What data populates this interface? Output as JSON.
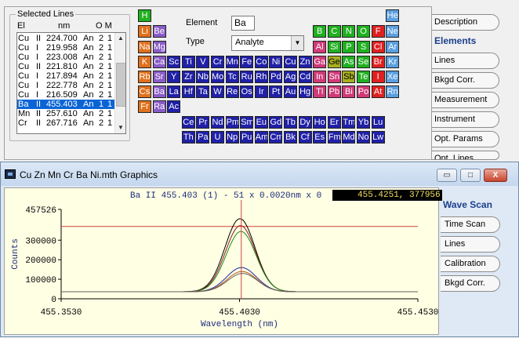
{
  "selected_lines": {
    "title": "Selected Lines",
    "headers": {
      "el": "El",
      "nm": "nm",
      "om": "O M"
    },
    "rows": [
      {
        "el": "Cu",
        "ion": "II",
        "nm": "224.700",
        "o": "An",
        "m1": "2",
        "m2": "1"
      },
      {
        "el": "Cu",
        "ion": "I",
        "nm": "219.958",
        "o": "An",
        "m1": "2",
        "m2": "1"
      },
      {
        "el": "Cu",
        "ion": "I",
        "nm": "223.008",
        "o": "An",
        "m1": "2",
        "m2": "1"
      },
      {
        "el": "Cu",
        "ion": "II",
        "nm": "221.810",
        "o": "An",
        "m1": "2",
        "m2": "1"
      },
      {
        "el": "Cu",
        "ion": "I",
        "nm": "217.894",
        "o": "An",
        "m1": "2",
        "m2": "1"
      },
      {
        "el": "Cu",
        "ion": "I",
        "nm": "222.778",
        "o": "An",
        "m1": "2",
        "m2": "1"
      },
      {
        "el": "Cu",
        "ion": "I",
        "nm": "216.509",
        "o": "An",
        "m1": "2",
        "m2": "1"
      },
      {
        "el": "Ba",
        "ion": "II",
        "nm": "455.403",
        "o": "An",
        "m1": "1",
        "m2": "1",
        "selected": true
      },
      {
        "el": "Mn",
        "ion": "II",
        "nm": "257.610",
        "o": "An",
        "m1": "2",
        "m2": "1"
      },
      {
        "el": "Cr",
        "ion": "II",
        "nm": "267.716",
        "o": "An",
        "m1": "2",
        "m2": "1"
      }
    ]
  },
  "element_form": {
    "element_label": "Element",
    "element_value": "Ba",
    "type_label": "Type",
    "type_value": "Analyte"
  },
  "colors": {
    "orange": "#e0701c",
    "purple": "#8a5cc7",
    "blue": "#2020a8",
    "green": "#20b020",
    "red": "#e02020",
    "light_blue": "#5a9fe0",
    "pink": "#d03a78",
    "olive": "#a8b020",
    "selected_row": "#0a64d6"
  },
  "periodic_table": [
    {
      "s": "H",
      "c": "green",
      "r": 0,
      "col": 0
    },
    {
      "s": "He",
      "c": "light_blue",
      "r": 0,
      "col": 17
    },
    {
      "s": "Li",
      "c": "orange",
      "r": 1,
      "col": 0
    },
    {
      "s": "Be",
      "c": "purple",
      "r": 1,
      "col": 1
    },
    {
      "s": "B",
      "c": "green",
      "r": 1,
      "col": 12
    },
    {
      "s": "C",
      "c": "green",
      "r": 1,
      "col": 13
    },
    {
      "s": "N",
      "c": "green",
      "r": 1,
      "col": 14
    },
    {
      "s": "O",
      "c": "green",
      "r": 1,
      "col": 15
    },
    {
      "s": "F",
      "c": "red",
      "r": 1,
      "col": 16
    },
    {
      "s": "Ne",
      "c": "light_blue",
      "r": 1,
      "col": 17
    },
    {
      "s": "Na",
      "c": "orange",
      "r": 2,
      "col": 0
    },
    {
      "s": "Mg",
      "c": "purple",
      "r": 2,
      "col": 1
    },
    {
      "s": "Al",
      "c": "pink",
      "r": 2,
      "col": 12
    },
    {
      "s": "Si",
      "c": "green",
      "r": 2,
      "col": 13
    },
    {
      "s": "P",
      "c": "green",
      "r": 2,
      "col": 14
    },
    {
      "s": "S",
      "c": "green",
      "r": 2,
      "col": 15
    },
    {
      "s": "Cl",
      "c": "red",
      "r": 2,
      "col": 16
    },
    {
      "s": "Ar",
      "c": "light_blue",
      "r": 2,
      "col": 17
    },
    {
      "s": "K",
      "c": "orange",
      "r": 3,
      "col": 0
    },
    {
      "s": "Ca",
      "c": "purple",
      "r": 3,
      "col": 1
    },
    {
      "s": "Sc",
      "c": "blue",
      "r": 3,
      "col": 2
    },
    {
      "s": "Ti",
      "c": "blue",
      "r": 3,
      "col": 3
    },
    {
      "s": "V",
      "c": "blue",
      "r": 3,
      "col": 4
    },
    {
      "s": "Cr",
      "c": "blue",
      "r": 3,
      "col": 5
    },
    {
      "s": "Mn",
      "c": "blue",
      "r": 3,
      "col": 6
    },
    {
      "s": "Fe",
      "c": "blue",
      "r": 3,
      "col": 7
    },
    {
      "s": "Co",
      "c": "blue",
      "r": 3,
      "col": 8
    },
    {
      "s": "Ni",
      "c": "blue",
      "r": 3,
      "col": 9
    },
    {
      "s": "Cu",
      "c": "blue",
      "r": 3,
      "col": 10
    },
    {
      "s": "Zn",
      "c": "blue",
      "r": 3,
      "col": 11
    },
    {
      "s": "Ga",
      "c": "pink",
      "r": 3,
      "col": 12
    },
    {
      "s": "Ge",
      "c": "olive",
      "r": 3,
      "col": 13
    },
    {
      "s": "As",
      "c": "green",
      "r": 3,
      "col": 14
    },
    {
      "s": "Se",
      "c": "green",
      "r": 3,
      "col": 15
    },
    {
      "s": "Br",
      "c": "red",
      "r": 3,
      "col": 16
    },
    {
      "s": "Kr",
      "c": "light_blue",
      "r": 3,
      "col": 17
    },
    {
      "s": "Rb",
      "c": "orange",
      "r": 4,
      "col": 0
    },
    {
      "s": "Sr",
      "c": "purple",
      "r": 4,
      "col": 1
    },
    {
      "s": "Y",
      "c": "blue",
      "r": 4,
      "col": 2
    },
    {
      "s": "Zr",
      "c": "blue",
      "r": 4,
      "col": 3
    },
    {
      "s": "Nb",
      "c": "blue",
      "r": 4,
      "col": 4
    },
    {
      "s": "Mo",
      "c": "blue",
      "r": 4,
      "col": 5
    },
    {
      "s": "Tc",
      "c": "blue",
      "r": 4,
      "col": 6
    },
    {
      "s": "Ru",
      "c": "blue",
      "r": 4,
      "col": 7
    },
    {
      "s": "Rh",
      "c": "blue",
      "r": 4,
      "col": 8
    },
    {
      "s": "Pd",
      "c": "blue",
      "r": 4,
      "col": 9
    },
    {
      "s": "Ag",
      "c": "blue",
      "r": 4,
      "col": 10
    },
    {
      "s": "Cd",
      "c": "blue",
      "r": 4,
      "col": 11
    },
    {
      "s": "In",
      "c": "pink",
      "r": 4,
      "col": 12
    },
    {
      "s": "Sn",
      "c": "pink",
      "r": 4,
      "col": 13
    },
    {
      "s": "Sb",
      "c": "olive",
      "r": 4,
      "col": 14
    },
    {
      "s": "Te",
      "c": "green",
      "r": 4,
      "col": 15
    },
    {
      "s": "I",
      "c": "red",
      "r": 4,
      "col": 16
    },
    {
      "s": "Xe",
      "c": "light_blue",
      "r": 4,
      "col": 17
    },
    {
      "s": "Cs",
      "c": "orange",
      "r": 5,
      "col": 0
    },
    {
      "s": "Ba",
      "c": "purple",
      "r": 5,
      "col": 1
    },
    {
      "s": "La",
      "c": "blue",
      "r": 5,
      "col": 2
    },
    {
      "s": "Hf",
      "c": "blue",
      "r": 5,
      "col": 3
    },
    {
      "s": "Ta",
      "c": "blue",
      "r": 5,
      "col": 4
    },
    {
      "s": "W",
      "c": "blue",
      "r": 5,
      "col": 5
    },
    {
      "s": "Re",
      "c": "blue",
      "r": 5,
      "col": 6
    },
    {
      "s": "Os",
      "c": "blue",
      "r": 5,
      "col": 7
    },
    {
      "s": "Ir",
      "c": "blue",
      "r": 5,
      "col": 8
    },
    {
      "s": "Pt",
      "c": "blue",
      "r": 5,
      "col": 9
    },
    {
      "s": "Au",
      "c": "blue",
      "r": 5,
      "col": 10
    },
    {
      "s": "Hg",
      "c": "blue",
      "r": 5,
      "col": 11
    },
    {
      "s": "Tl",
      "c": "pink",
      "r": 5,
      "col": 12
    },
    {
      "s": "Pb",
      "c": "pink",
      "r": 5,
      "col": 13
    },
    {
      "s": "Bi",
      "c": "pink",
      "r": 5,
      "col": 14
    },
    {
      "s": "Po",
      "c": "pink",
      "r": 5,
      "col": 15
    },
    {
      "s": "At",
      "c": "red",
      "r": 5,
      "col": 16
    },
    {
      "s": "Rn",
      "c": "light_blue",
      "r": 5,
      "col": 17
    },
    {
      "s": "Fr",
      "c": "orange",
      "r": 6,
      "col": 0
    },
    {
      "s": "Ra",
      "c": "purple",
      "r": 6,
      "col": 1
    },
    {
      "s": "Ac",
      "c": "blue",
      "r": 6,
      "col": 2
    },
    {
      "s": "Ce",
      "c": "blue",
      "r": 7,
      "col": 3
    },
    {
      "s": "Pr",
      "c": "blue",
      "r": 7,
      "col": 4
    },
    {
      "s": "Nd",
      "c": "blue",
      "r": 7,
      "col": 5
    },
    {
      "s": "Pm",
      "c": "blue",
      "r": 7,
      "col": 6
    },
    {
      "s": "Sm",
      "c": "blue",
      "r": 7,
      "col": 7
    },
    {
      "s": "Eu",
      "c": "blue",
      "r": 7,
      "col": 8
    },
    {
      "s": "Gd",
      "c": "blue",
      "r": 7,
      "col": 9
    },
    {
      "s": "Tb",
      "c": "blue",
      "r": 7,
      "col": 10
    },
    {
      "s": "Dy",
      "c": "blue",
      "r": 7,
      "col": 11
    },
    {
      "s": "Ho",
      "c": "blue",
      "r": 7,
      "col": 12
    },
    {
      "s": "Er",
      "c": "blue",
      "r": 7,
      "col": 13
    },
    {
      "s": "Tm",
      "c": "blue",
      "r": 7,
      "col": 14
    },
    {
      "s": "Yb",
      "c": "blue",
      "r": 7,
      "col": 15
    },
    {
      "s": "Lu",
      "c": "blue",
      "r": 7,
      "col": 16
    },
    {
      "s": "Th",
      "c": "blue",
      "r": 8,
      "col": 3
    },
    {
      "s": "Pa",
      "c": "blue",
      "r": 8,
      "col": 4
    },
    {
      "s": "U",
      "c": "blue",
      "r": 8,
      "col": 5
    },
    {
      "s": "Np",
      "c": "blue",
      "r": 8,
      "col": 6
    },
    {
      "s": "Pu",
      "c": "blue",
      "r": 8,
      "col": 7
    },
    {
      "s": "Am",
      "c": "blue",
      "r": 8,
      "col": 8
    },
    {
      "s": "Cm",
      "c": "blue",
      "r": 8,
      "col": 9
    },
    {
      "s": "Bk",
      "c": "blue",
      "r": 8,
      "col": 10
    },
    {
      "s": "Cf",
      "c": "blue",
      "r": 8,
      "col": 11
    },
    {
      "s": "Es",
      "c": "blue",
      "r": 8,
      "col": 12
    },
    {
      "s": "Fm",
      "c": "blue",
      "r": 8,
      "col": 13
    },
    {
      "s": "Md",
      "c": "blue",
      "r": 8,
      "col": 14
    },
    {
      "s": "No",
      "c": "blue",
      "r": 8,
      "col": 15
    },
    {
      "s": "Lw",
      "c": "blue",
      "r": 8,
      "col": 16
    }
  ],
  "right_tabs": [
    {
      "label": "Description"
    },
    {
      "label": "Elements",
      "active": true
    },
    {
      "label": "Lines"
    },
    {
      "label": "Bkgd Corr."
    },
    {
      "label": "Measurement"
    },
    {
      "label": "Instrument"
    },
    {
      "label": "Opt. Params"
    },
    {
      "label": "Opt. Lines"
    }
  ],
  "graphics_window": {
    "title": "Cu Zn Mn Cr Ba Ni.mth Graphics",
    "min_label": "▭",
    "max_label": "□",
    "close_label": "X",
    "plot_header": "Ba II 455.403 (1) - 51 x 0.0020nm x 0",
    "cursor_readout": "455.4251, 377956",
    "tabs": [
      {
        "label": "Wave Scan",
        "active": true
      },
      {
        "label": "Time Scan"
      },
      {
        "label": "Lines"
      },
      {
        "label": "Calibration"
      },
      {
        "label": "Bkgd Corr."
      }
    ]
  },
  "chart_data": {
    "type": "line",
    "xlabel": "Wavelength (nm)",
    "ylabel": "Counts",
    "xlim": [
      455.353,
      455.453
    ],
    "ylim": [
      0,
      457526
    ],
    "x_ticks": [
      "455.3530",
      "455.4030",
      "455.4530"
    ],
    "y_ticks": [
      {
        "v": 457526,
        "label": "457526"
      },
      {
        "v": 300000,
        "label": "300000"
      },
      {
        "v": 200000,
        "label": "200000"
      },
      {
        "v": 100000,
        "label": "100000"
      },
      {
        "v": 0,
        "label": "0"
      }
    ],
    "peak_center": 455.4035,
    "peak_width": 0.0042,
    "baseline": 36000,
    "series_colors": [
      "#000000",
      "#8b1a1a",
      "#1e8b1e",
      "#1a2aa0",
      "#b8541a",
      "#606060"
    ],
    "peaks": [
      410000,
      375000,
      345000,
      160000,
      140000,
      130000
    ],
    "cursor_x": 455.4035,
    "marker_level": 370000,
    "marker_color": "#d04040"
  }
}
